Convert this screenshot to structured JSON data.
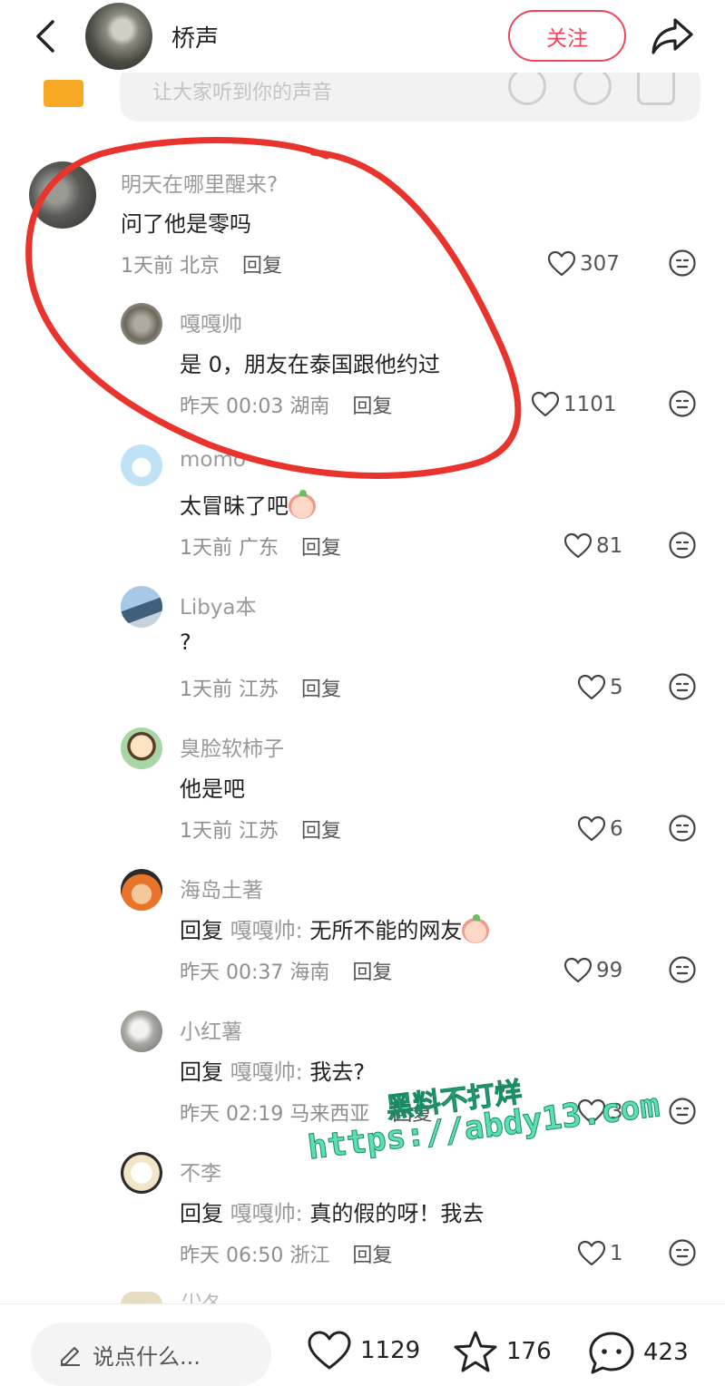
{
  "header": {
    "title": "桥声",
    "follow_label": "关注",
    "icons": {
      "back": "chevron-left-icon",
      "share": "share-arrow-icon"
    }
  },
  "input_strip": {
    "placeholder": "让大家听到你的声音"
  },
  "comments": [
    {
      "username": "明天在哪里醒来?",
      "text": "问了他是零吗",
      "time": "1天前",
      "location": "北京",
      "reply_label": "回复",
      "likes": "307"
    },
    {
      "username": "嘎嘎帅",
      "text": "是 0，朋友在泰国跟他约过",
      "time": "昨天 00:03",
      "location": "湖南",
      "reply_label": "回复",
      "likes": "1101"
    },
    {
      "username": "momo",
      "text": "太冒昧了吧",
      "time": "1天前",
      "location": "广东",
      "reply_label": "回复",
      "likes": "81"
    },
    {
      "username": "Libya本",
      "text": "?",
      "time": "1天前",
      "location": "江苏",
      "reply_label": "回复",
      "likes": "5"
    },
    {
      "username": "臭脸软柿子",
      "text": "他是吧",
      "time": "1天前",
      "location": "江苏",
      "reply_label": "回复",
      "likes": "6"
    },
    {
      "username": "海岛土著",
      "reply_prefix": "回复",
      "reply_target": "嘎嘎帅:",
      "text": " 无所不能的网友",
      "time": "昨天 00:37",
      "location": "海南",
      "reply_label": "回复",
      "likes": "99"
    },
    {
      "username": "小红薯",
      "reply_prefix": "回复",
      "reply_target": "嘎嘎帅:",
      "text": " 我去?",
      "time": "昨天 02:19",
      "location": "马来西亚",
      "reply_label": "回复",
      "likes": "3"
    },
    {
      "username": "不李",
      "reply_prefix": "回复",
      "reply_target": "嘎嘎帅:",
      "text": " 真的假的呀！我去",
      "time": "昨天 06:50",
      "location": "浙江",
      "reply_label": "回复",
      "likes": "1"
    }
  ],
  "partial_next": {
    "username": "小发"
  },
  "watermark": {
    "line1": "黑料不打烊",
    "line2": "https://abdy13.com"
  },
  "bottom_bar": {
    "input_placeholder": "说点什么...",
    "likes": "1129",
    "favorites": "176",
    "comments": "423"
  },
  "colors": {
    "accent": "#f0455a",
    "annotation": "#e8342c",
    "watermark": "#4fd6a6"
  }
}
